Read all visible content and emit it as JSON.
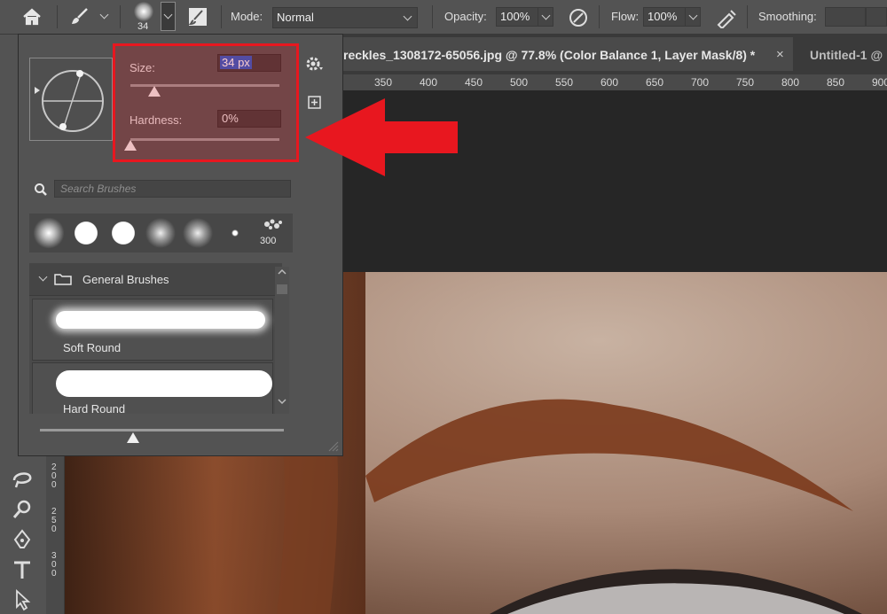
{
  "options_bar": {
    "brush_size_label": "34",
    "mode_label": "Mode:",
    "mode_value": "Normal",
    "opacity_label": "Opacity:",
    "opacity_value": "100%",
    "flow_label": "Flow:",
    "flow_value": "100%",
    "smoothing_label": "Smoothing:"
  },
  "tabs": {
    "active": "reckles_1308172-65056.jpg @ 77.8% (Color Balance 1, Layer Mask/8) *",
    "close_glyph": "×",
    "second": "Untitled-1 @"
  },
  "ruler_h_ticks": [
    "350",
    "400",
    "450",
    "500",
    "550",
    "600",
    "650",
    "700",
    "750",
    "800",
    "850",
    "900"
  ],
  "ruler_v_ticks": [
    "2 0 0",
    "2 5 0",
    "3 0 0"
  ],
  "brush_panel": {
    "size_label": "Size:",
    "size_value": "34 px",
    "size_fraction": 0.16,
    "hardness_label": "Hardness:",
    "hardness_value": "0%",
    "hardness_fraction": 0.0,
    "search_placeholder": "Search Brushes",
    "preset_count_label": "300",
    "group_name": "General Brushes",
    "brushes": [
      "Soft Round",
      "Hard Round"
    ]
  },
  "colors": {
    "highlight_red": "#e8171f",
    "panel_bg": "#535353",
    "size_value_selection": "#2a5cc8"
  }
}
